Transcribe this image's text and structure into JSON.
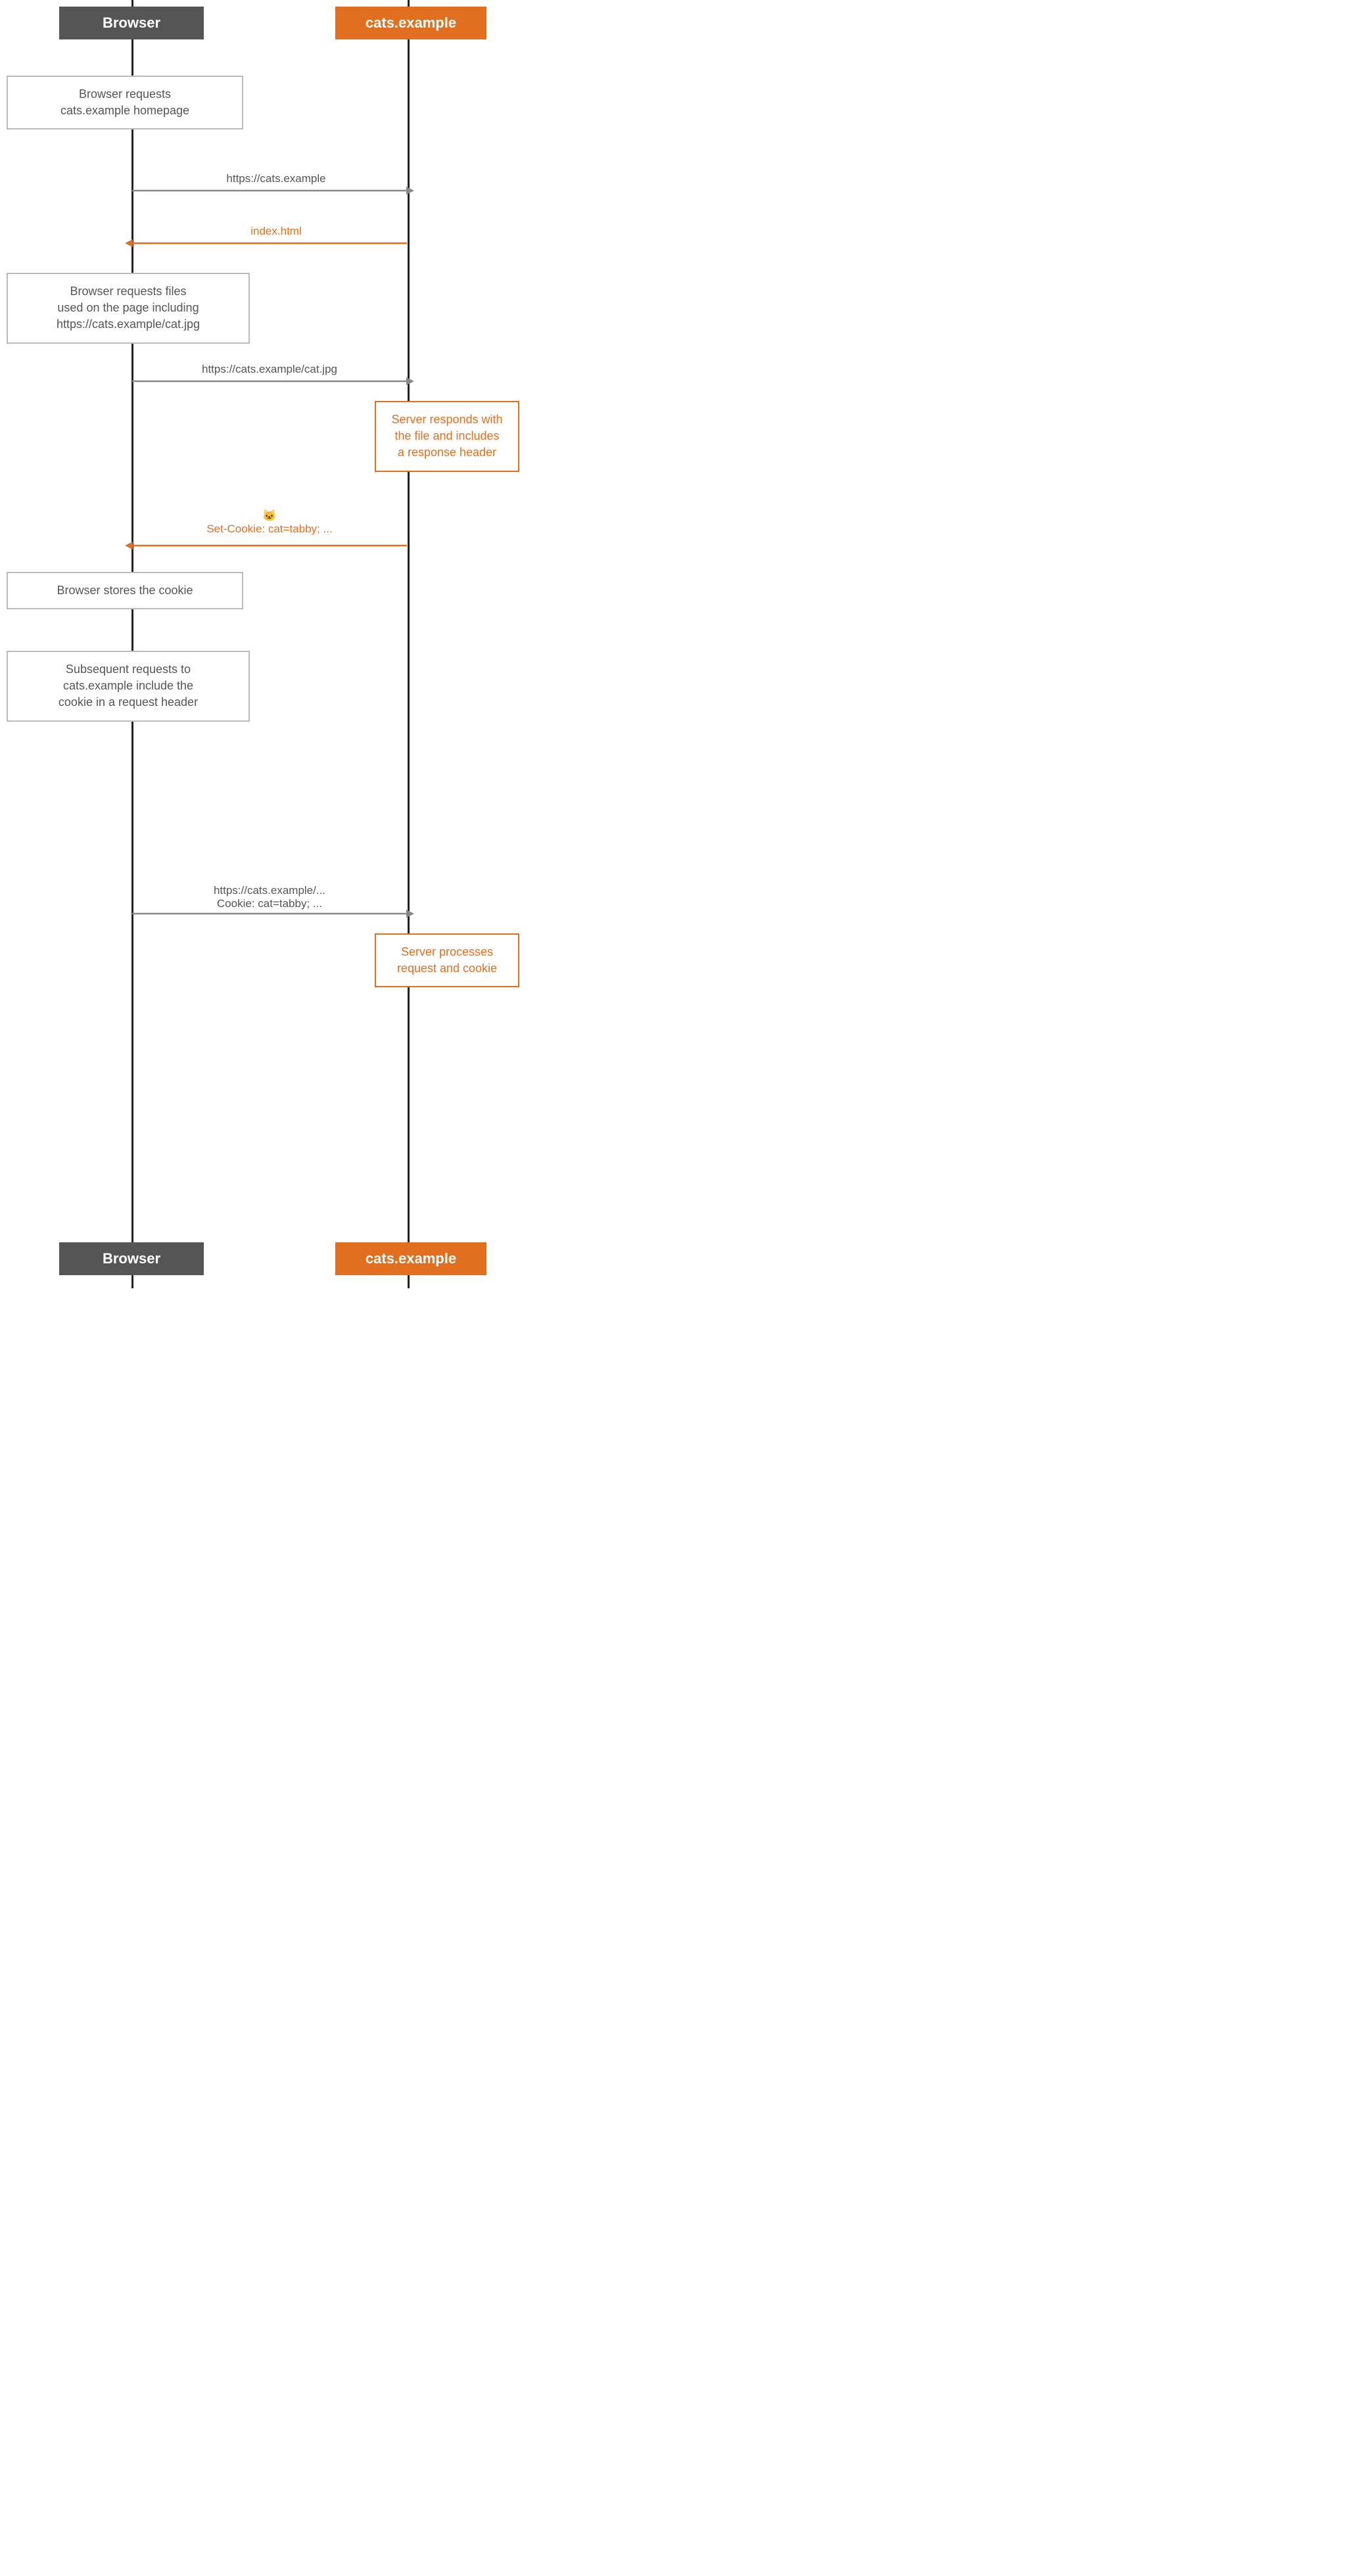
{
  "header": {
    "browser_label": "Browser",
    "cats_label": "cats.example"
  },
  "footer": {
    "browser_label": "Browser",
    "cats_label": "cats.example"
  },
  "notes": [
    {
      "id": "note-browser-requests-homepage",
      "text": "Browser requests\ncats.example homepage",
      "type": "gray"
    },
    {
      "id": "note-browser-requests-files",
      "text": "Browser requests files\nused on the page including\nhttps://cats.example/cat.jpg",
      "type": "gray"
    },
    {
      "id": "note-server-responds",
      "text": "Server responds with\nthe file and includes\na response header",
      "type": "orange"
    },
    {
      "id": "note-browser-stores",
      "text": "Browser stores the cookie",
      "type": "gray"
    },
    {
      "id": "note-subsequent-requests",
      "text": "Subsequent requests to\ncats.example include the\ncookie in a request header",
      "type": "gray"
    },
    {
      "id": "note-server-processes",
      "text": "Server processes\nrequest and cookie",
      "type": "orange"
    }
  ],
  "arrows": [
    {
      "id": "arrow-https-cats",
      "label": "https://cats.example",
      "direction": "right",
      "color": "gray"
    },
    {
      "id": "arrow-index-html",
      "label": "index.html",
      "direction": "left",
      "color": "orange"
    },
    {
      "id": "arrow-cat-jpg",
      "label": "https://cats.example/cat.jpg",
      "direction": "right",
      "color": "gray"
    },
    {
      "id": "arrow-set-cookie",
      "label": "🐱\nSet-Cookie: cat=tabby; ...",
      "direction": "left",
      "color": "orange"
    },
    {
      "id": "arrow-subsequent",
      "label": "https://cats.example/...\nCookie: cat=tabby; ...",
      "direction": "right",
      "color": "gray"
    }
  ]
}
